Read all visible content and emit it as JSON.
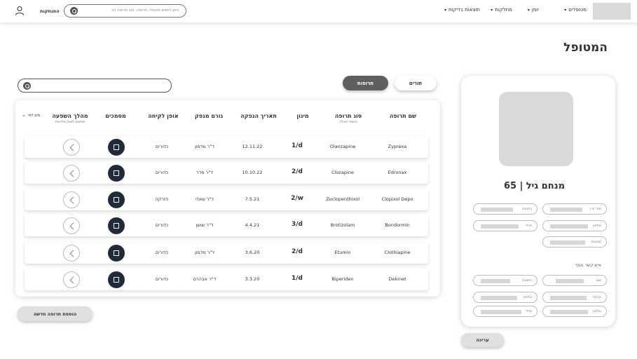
{
  "nav": {
    "items": [
      {
        "label": "מטופלים"
      },
      {
        "label": "יומן"
      },
      {
        "label": "מחלקות"
      },
      {
        "label": "תוצאות בדיקות"
      }
    ],
    "search_placeholder": "ניתן לחפש מטופל, תרופה, סוג תרופה וכו",
    "logout_label": "התנתקות"
  },
  "page": {
    "title": "המטופל"
  },
  "tabs": {
    "turns_label": "תורים",
    "meds_label": "תרופות"
  },
  "table": {
    "headers": {
      "name": "שם תרופה",
      "type": "סוג תרופה",
      "type_sub": "(חומר פעיל)",
      "dose": "מינון",
      "date": "תאריך הנפקה",
      "issuer": "גורם מנפק",
      "method": "אופן לקיחה",
      "docs": "מסמכים",
      "effect": "מהלך השפעה",
      "effect_sub": "תופעות לוואי/ אלרגיות"
    },
    "sort_label": "מיון לפי",
    "rows": [
      {
        "name": "Zyprexa",
        "type": "Olanzapine",
        "dose": "1/d",
        "date": "12.11.22",
        "issuer": "ד\"ר מדסון",
        "method": "כדורים"
      },
      {
        "name": "Edronax",
        "type": "Clozapine",
        "dose": "2/d",
        "date": "10.10.22",
        "issuer": "ד\"ר מדר",
        "method": "כדורים"
      },
      {
        "name": "Clopixol Depo",
        "type": "Zuclopenthixol",
        "dose": "2/w",
        "date": "7.5.21",
        "issuer": "ד\"ר שאדי",
        "method": "הזרקה"
      },
      {
        "name": "Bondormin",
        "type": "Brotizolam",
        "dose": "3/d",
        "date": "4.4.21",
        "issuer": "ד\"ר שושן",
        "method": "כדורים"
      },
      {
        "name": "Clothiapine",
        "type": "Etumin",
        "dose": "2/d",
        "date": "3.6.20",
        "issuer": "ד\"ר מדסון",
        "method": "כדורים"
      },
      {
        "name": "Dekinet",
        "type": "Biperiden",
        "dose": "1/d",
        "date": "3.3.20",
        "issuer": "ד\"ר אבהרם",
        "method": "כדורים"
      }
    ]
  },
  "add_button_label": "הוספת תרופה חדשה",
  "patient": {
    "name": "מנחם גיל",
    "age": "65",
    "fields": {
      "id": "מס' ת.ז",
      "address": "כתובת",
      "phone": "טלפון",
      "email": "מייל",
      "status": "סטטוס"
    },
    "contact_title": "איש קשר נוסף",
    "contact_fields": {
      "name": "שם",
      "address": "כתובת",
      "relation": "קרבה",
      "phone": "טלפון",
      "phone2": "טלפון",
      "email": "מייל"
    }
  },
  "edit_button_label": "עריכה"
}
